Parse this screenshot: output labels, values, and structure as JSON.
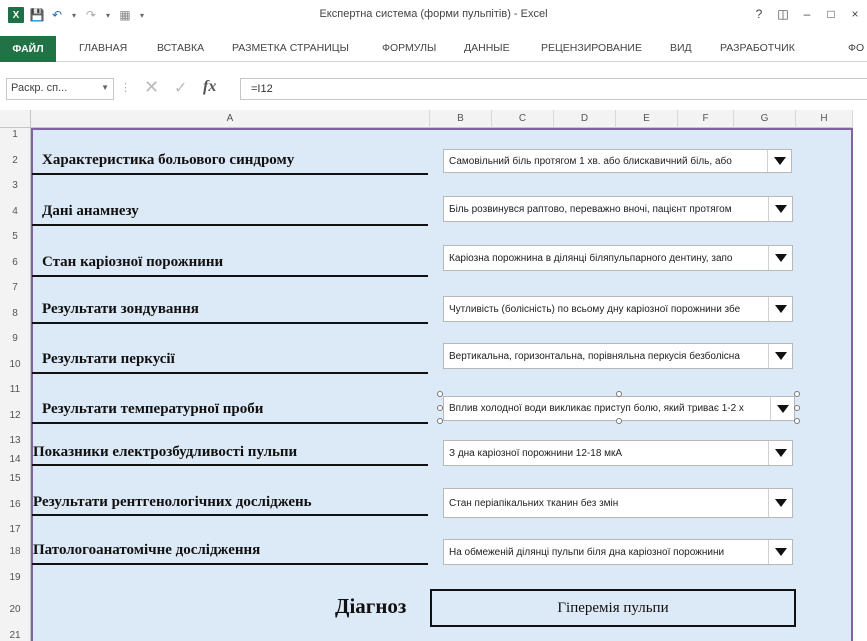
{
  "window": {
    "title": "Експертна система (форми пульпітів) - Excel",
    "help": "?",
    "controls": [
      "–",
      "□",
      "×"
    ]
  },
  "ribbon": {
    "file": "ФАЙЛ",
    "tabs": [
      "ГЛАВНАЯ",
      "ВСТАВКА",
      "РАЗМЕТКА СТРАНИЦЫ",
      "ФОРМУЛЫ",
      "ДАННЫЕ",
      "РЕЦЕНЗИРОВАНИЕ",
      "ВИД",
      "РАЗРАБОТЧИК",
      "ФО"
    ]
  },
  "formula_bar": {
    "name_box": "Раскр. сп...",
    "fx": "fx",
    "formula": "=I12"
  },
  "columns": [
    "A",
    "B",
    "C",
    "D",
    "E",
    "F",
    "G",
    "H"
  ],
  "rows": [
    "1",
    "2",
    "3",
    "4",
    "5",
    "6",
    "7",
    "8",
    "9",
    "10",
    "11",
    "12",
    "13",
    "14",
    "15",
    "16",
    "17",
    "18",
    "19",
    "20",
    "21"
  ],
  "fields": [
    {
      "label": "Характеристика больового синдрому",
      "value": "Самовільний біль протягом 1 хв. або блискавичний біль, або"
    },
    {
      "label": "Дані анамнезу",
      "value": "Біль розвинувся раптово, переважно вночі, пацієнт протягом"
    },
    {
      "label": "Стан каріозної порожнини",
      "value": "Каріозна порожнина в ділянці біляпульпарного дентину, запо"
    },
    {
      "label": "Результати зондування",
      "value": "Чутливість (болісність) по всьому дну каріозної порожнини збе"
    },
    {
      "label": "Результати перкусії",
      "value": "Вертикальна, горизонтальна, порівняльна перкусія безболісна"
    },
    {
      "label": "Результати температурної проби",
      "value": "Вплив холодної води викликає приступ болю, який триває 1-2 х"
    },
    {
      "label": "Показники електрозбудливості пульпи",
      "value": "З дна каріозної порожнини 12-18 мкА"
    },
    {
      "label": "Результати рентгенологічних досліджень",
      "value": "Стан періапікальних тканин без змін"
    },
    {
      "label": "Патологоанатомічне дослідження",
      "value": "На обмеженій ділянці пульпи біля дна каріозної порожнини"
    }
  ],
  "diagnosis": {
    "label": "Діагноз",
    "value": "Гіперемія пульпи"
  },
  "colors": {
    "excel_green": "#217346",
    "sheet_fill": "#dce9f6",
    "border_purple": "#8064a2"
  }
}
